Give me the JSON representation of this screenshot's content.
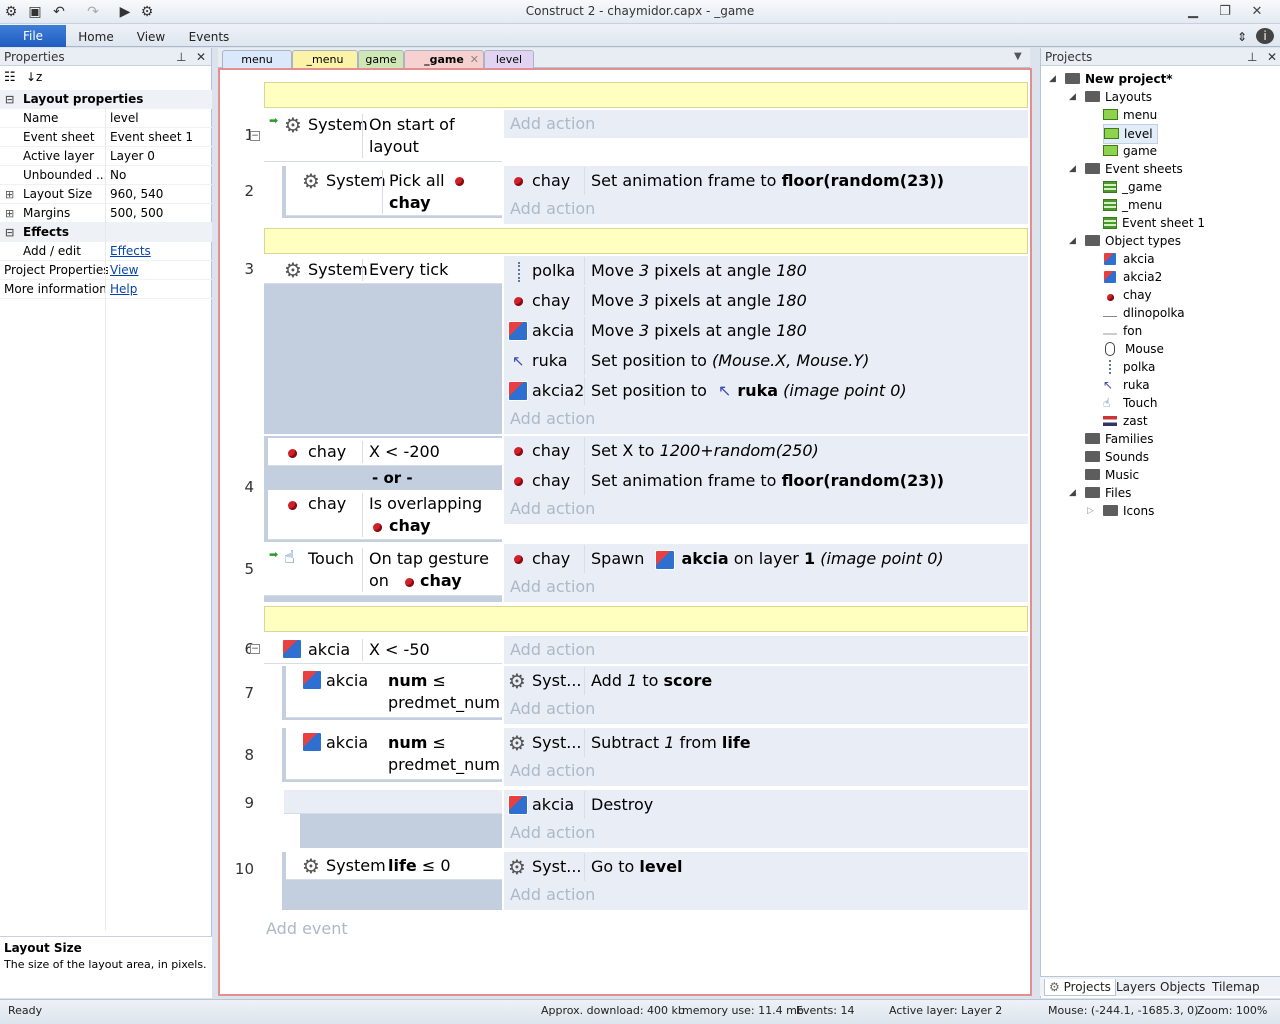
{
  "window": {
    "title": "Construct 2 - chaymidor.capx - _game"
  },
  "ribbon": {
    "file": "File",
    "home": "Home",
    "view": "View",
    "events": "Events"
  },
  "properties": {
    "header": "Properties",
    "layout_category": "Layout properties",
    "rows": [
      {
        "key": "Name",
        "value": "level"
      },
      {
        "key": "Event sheet",
        "value": "Event sheet 1"
      },
      {
        "key": "Active layer",
        "value": "Layer 0"
      },
      {
        "key": "Unbounded ...",
        "value": "No"
      },
      {
        "key": "Layout Size",
        "value": "960, 540"
      },
      {
        "key": "Margins",
        "value": "500, 500"
      }
    ],
    "effects_category": "Effects",
    "effects_key": "Add / edit",
    "effects_link": "Effects",
    "project_props_key": "Project Properties",
    "project_props_link": "View",
    "more_info_key": "More information",
    "more_info_link": "Help",
    "desc_title": "Layout Size",
    "desc_text": "The size of the layout area, in pixels."
  },
  "sheet_tabs": [
    "menu",
    "_menu",
    "game",
    "_game",
    "level"
  ],
  "events": {
    "add_action": "Add action",
    "add_event": "Add event",
    "e1": {
      "num": "1",
      "obj": "System",
      "cond": "On start of layout"
    },
    "e2": {
      "num": "2",
      "obj": "System",
      "cond_a": "Pick all",
      "cond_b": "chay",
      "act_obj": "chay",
      "act_a": "Set animation frame to ",
      "act_b": "floor(random(23))"
    },
    "e3": {
      "num": "3",
      "obj": "System",
      "cond": "Every tick",
      "actions": [
        {
          "obj": "polka",
          "a": "Move ",
          "b": "3",
          "c": " pixels at angle ",
          "d": "180"
        },
        {
          "obj": "chay",
          "a": "Move ",
          "b": "3",
          "c": " pixels at angle ",
          "d": "180"
        },
        {
          "obj": "akcia",
          "a": "Move ",
          "b": "3",
          "c": " pixels at angle ",
          "d": "180"
        }
      ],
      "ruka": {
        "obj": "ruka",
        "a": "Set position to ",
        "b": "(Mouse.X, Mouse.Y)"
      },
      "akcia2": {
        "obj": "akcia2",
        "a": "Set position to ",
        "b": "ruka",
        "c": " (image point 0)"
      }
    },
    "e4": {
      "num": "4",
      "obj1": "chay",
      "cond1": "X < -200",
      "or": "- or -",
      "obj2": "chay",
      "cond2": "Is overlapping",
      "cond2b": "chay",
      "act1_obj": "chay",
      "act1_a": "Set X to ",
      "act1_b": "1200+random(250)",
      "act2_obj": "chay",
      "act2_a": "Set animation frame to ",
      "act2_b": "floor(random(23))"
    },
    "e5": {
      "num": "5",
      "obj": "Touch",
      "cond_a": "On tap gesture",
      "cond_b": "on",
      "cond_c": "chay",
      "act_obj": "chay",
      "act_a": "Spawn ",
      "act_b": "akcia",
      "act_c": " on layer ",
      "act_d": "1",
      "act_e": " (image point 0)"
    },
    "e6": {
      "num": "6",
      "obj": "akcia",
      "cond": "X < -50"
    },
    "e7": {
      "num": "7",
      "obj": "akcia",
      "cond_a": "num",
      "cond_op": " ≤",
      "cond_b": "predmet_num",
      "act_obj": "Syst...",
      "act_a": "Add ",
      "act_b": "1",
      "act_c": " to ",
      "act_d": "score"
    },
    "e8": {
      "num": "8",
      "obj": "akcia",
      "cond_a": "num",
      "cond_op": " ≤",
      "cond_b": "predmet_num",
      "act_obj": "Syst...",
      "act_a": "Subtract ",
      "act_b": "1",
      "act_c": " from ",
      "act_d": "life"
    },
    "e9": {
      "num": "9",
      "act_obj": "akcia",
      "act_a": "Destroy"
    },
    "e10": {
      "num": "10",
      "obj": "System",
      "cond_a": "life",
      "cond_b": " ≤ 0",
      "act_obj": "Syst...",
      "act_a": "Go to ",
      "act_b": "level"
    }
  },
  "projects": {
    "header": "Projects",
    "root": "New project*",
    "layouts": "Layouts",
    "layout_items": [
      "menu",
      "level",
      "game"
    ],
    "event_sheets": "Event sheets",
    "sheet_items": [
      "_game",
      "_menu",
      "Event sheet 1"
    ],
    "object_types": "Object types",
    "object_items": [
      "akcia",
      "akcia2",
      "chay",
      "dlinopolka",
      "fon",
      "Mouse",
      "polka",
      "ruka",
      "Touch",
      "zast"
    ],
    "families": "Families",
    "sounds": "Sounds",
    "music": "Music",
    "files": "Files",
    "icons": "Icons",
    "tabs": [
      "Projects",
      "Layers",
      "Objects",
      "Tilemap"
    ]
  },
  "status": {
    "ready": "Ready",
    "download": "Approx. download: 400 kb",
    "memory": "memory use: 11.4 mb",
    "events": "Events: 14",
    "layer": "Active layer: Layer 2",
    "mouse": "Mouse: (-244.1, -1685.3, 0)",
    "zoom": "Zoom: 100%"
  }
}
